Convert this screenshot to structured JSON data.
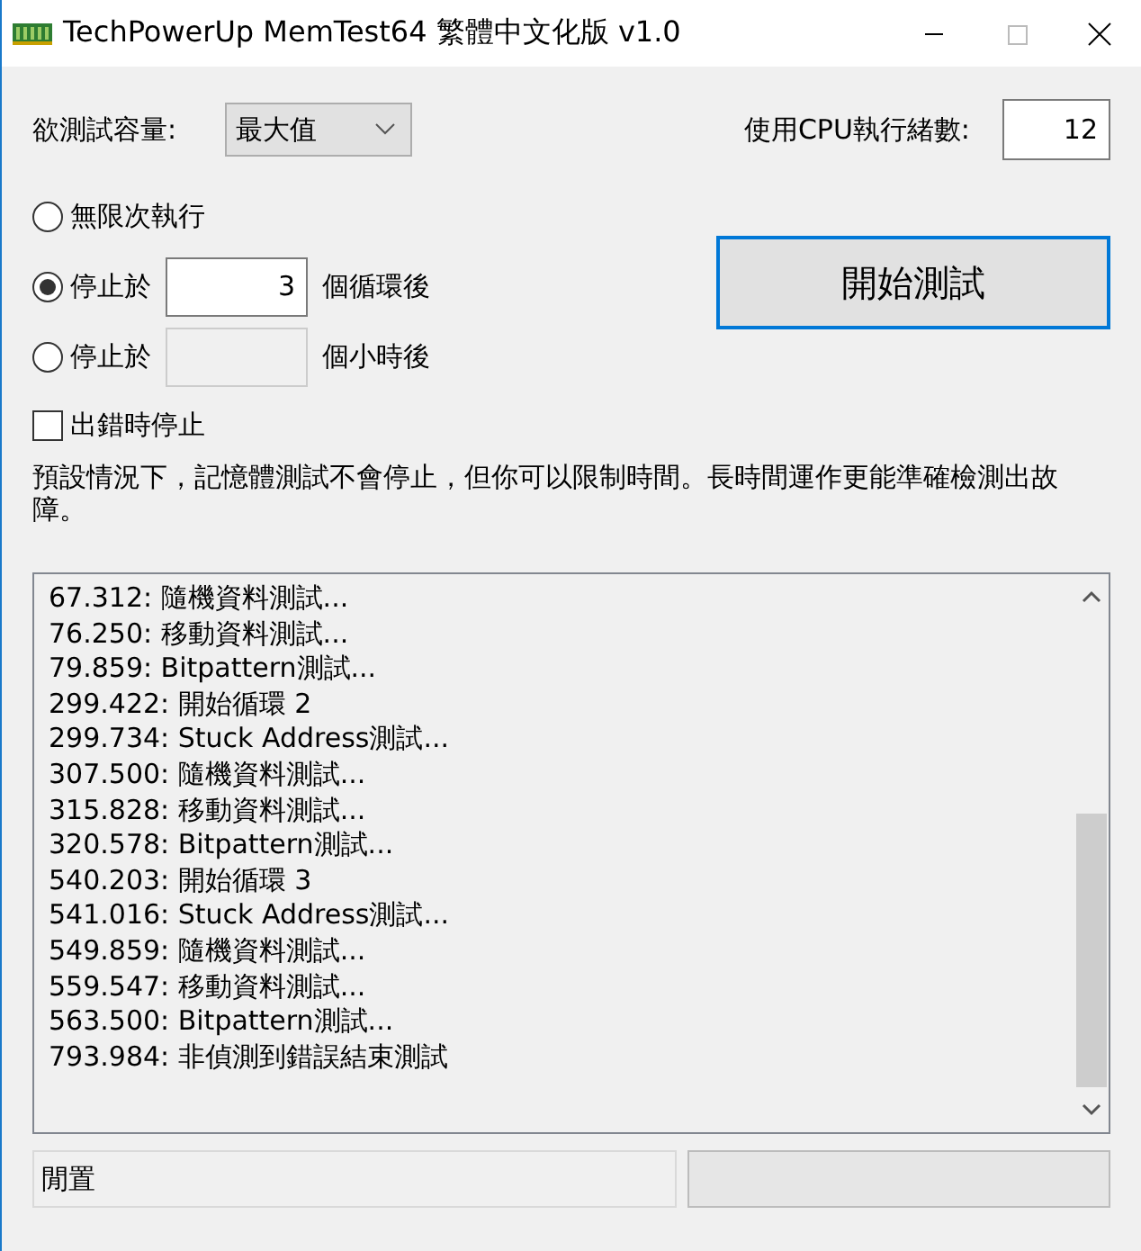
{
  "window": {
    "title": "TechPowerUp MemTest64 繁體中文化版 v1.0"
  },
  "capacity": {
    "label": "欲測試容量:",
    "value": "最大值"
  },
  "threads": {
    "label": "使用CPU執行緒數:",
    "value": "12"
  },
  "stop_modes": [
    {
      "kind": "infinite",
      "label": "無限次執行",
      "selected": false
    },
    {
      "kind": "field",
      "label": "停止於",
      "field": {
        "value": "3",
        "disabled": false
      },
      "suffix": "個循環後",
      "selected": true
    },
    {
      "kind": "field",
      "label": "停止於",
      "field": {
        "disabled": true
      },
      "suffix": "個小時後",
      "selected": false
    }
  ],
  "start_button": {
    "label": "開始測試",
    "focused": true
  },
  "stop_on_error": {
    "label": "出錯時停止",
    "checked": false
  },
  "description": "預設情況下，記憶體測試不會停止，但你可以限制時間。長時間運作更能準確檢測出故障。",
  "log": [
    "67.312: 隨機資料測試...",
    "76.250: 移動資料測試...",
    "79.859: Bitpattern測試...",
    "299.422: 開始循環 2",
    "299.734: Stuck Address測試...",
    "307.500: 隨機資料測試...",
    "315.828: 移動資料測試...",
    "320.578: Bitpattern測試...",
    "540.203: 開始循環 3",
    "541.016: Stuck Address測試...",
    "549.859: 隨機資料測試...",
    "559.547: 移動資料測試...",
    "563.500: Bitpattern測試...",
    "793.984: 非偵測到錯誤結束測試"
  ],
  "status_bar": {
    "text": "閒置"
  }
}
